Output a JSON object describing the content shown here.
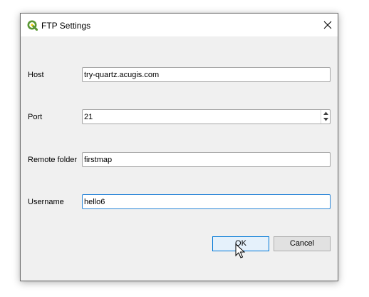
{
  "window": {
    "title": "FTP Settings",
    "app_icon": "qgis-logo-icon",
    "close_icon": "close-icon"
  },
  "form": {
    "host": {
      "label": "Host",
      "value": "try-quartz.acugis.com"
    },
    "port": {
      "label": "Port",
      "value": "21"
    },
    "remote_folder": {
      "label": "Remote folder",
      "value": "firstmap"
    },
    "username": {
      "label": "Username",
      "value": "hello6"
    }
  },
  "buttons": {
    "ok_label": "OK",
    "cancel_label": "Cancel"
  },
  "colors": {
    "accent": "#0078d7",
    "focus_border": "#2b86d8",
    "dialog_bg": "#f0f0f0",
    "qgis_green": "#589632"
  }
}
